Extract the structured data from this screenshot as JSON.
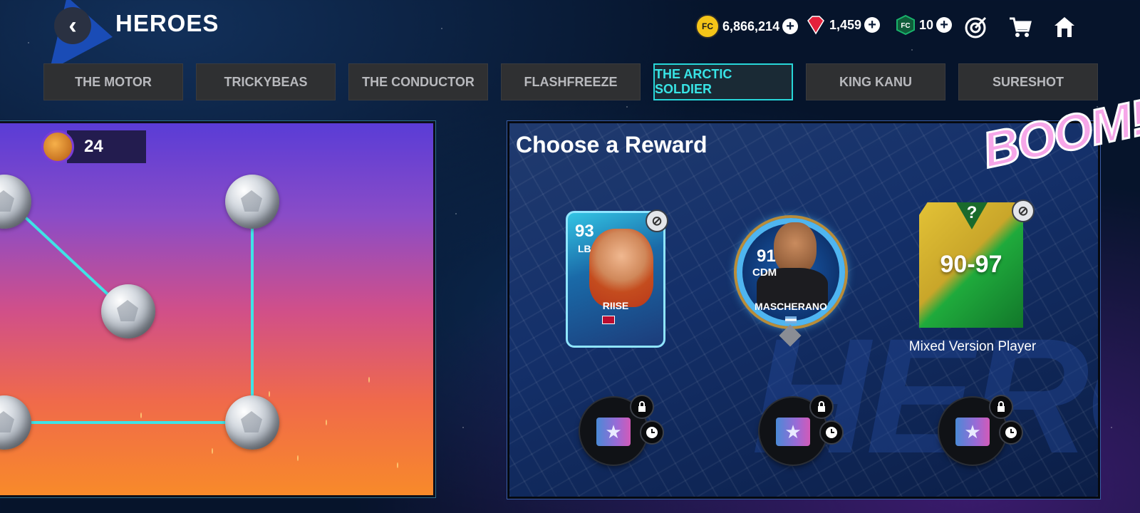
{
  "header": {
    "title": "HEROES",
    "back_glyph": "‹"
  },
  "currencies": [
    {
      "icon": "fc-points-icon",
      "value": "6,866,214",
      "color": "#f5c518"
    },
    {
      "icon": "gems-icon",
      "value": "1,459",
      "color": "#e4213b"
    },
    {
      "icon": "fc-token-icon",
      "value": "10",
      "color": "#19b36b"
    }
  ],
  "top_icons": [
    "objectives-icon",
    "store-icon",
    "home-icon"
  ],
  "tabs": [
    {
      "label": "THE MOTOR",
      "active": false
    },
    {
      "label": "TRICKYBEAS",
      "active": false
    },
    {
      "label": "THE CONDUCTOR",
      "active": false
    },
    {
      "label": "FLASHFREEZE",
      "active": false
    },
    {
      "label": "THE ARCTIC SOLDIER",
      "active": true
    },
    {
      "label": "KING KANU",
      "active": false
    },
    {
      "label": "SURESHOT",
      "active": false
    }
  ],
  "path_panel": {
    "ball_count": "24"
  },
  "reward_panel": {
    "title": "Choose a Reward",
    "boom_text": "BOOM!",
    "background_text": "HERO",
    "cards": [
      {
        "rating": "93",
        "position": "LB",
        "name": "RIISE",
        "untradeable": true
      },
      {
        "rating": "91",
        "position": "CDM",
        "name": "MASCHERANO",
        "untradeable": false
      },
      {
        "range": "90-97",
        "label": "Mixed Version Player",
        "question_mark": "?",
        "untradeable": true
      }
    ],
    "packs": [
      {
        "locked": true,
        "timed": true
      },
      {
        "locked": true,
        "timed": true
      },
      {
        "locked": true,
        "timed": true
      }
    ]
  }
}
